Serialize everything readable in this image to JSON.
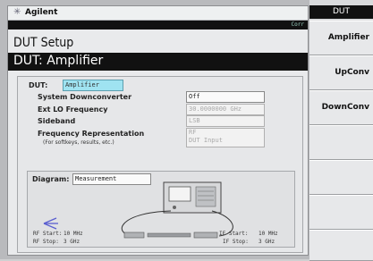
{
  "brand": "Agilent",
  "status_text": "Corr",
  "page_title": "DUT Setup",
  "header_bar": "DUT: Amplifier",
  "form": {
    "dut_label": "DUT:",
    "dut_value": "Amplifier",
    "rows": [
      {
        "label": "System Downconverter",
        "value": "Off",
        "dim": false
      },
      {
        "label": "Ext LO Frequency",
        "value": "30.0000000 GHz",
        "dim": true
      },
      {
        "label": "Sideband",
        "value": "LSB",
        "dim": true
      },
      {
        "label": "Frequency Representation",
        "value": "RF",
        "dim": true
      }
    ],
    "freq_rep_note": "(For softkeys, results, etc.)",
    "freq_rep_value2": "DUT Input"
  },
  "diagram": {
    "label": "Diagram:",
    "value": "Measurement",
    "rf_start_label": "RF Start:",
    "rf_start_value": "10 MHz",
    "rf_stop_label": "RF Stop:",
    "rf_stop_value": "3 GHz",
    "if_start_label": "IF Start:",
    "if_start_value": "10 MHz",
    "if_stop_label": "IF Stop:",
    "if_stop_value": "3 GHz"
  },
  "softkeys": {
    "title": "DUT",
    "keys": [
      "Amplifier",
      "UpConv",
      "DownConv",
      "",
      "",
      "",
      ""
    ]
  },
  "colors": {
    "accent_cyan": "#9fe3f1",
    "bar": "#111111"
  }
}
